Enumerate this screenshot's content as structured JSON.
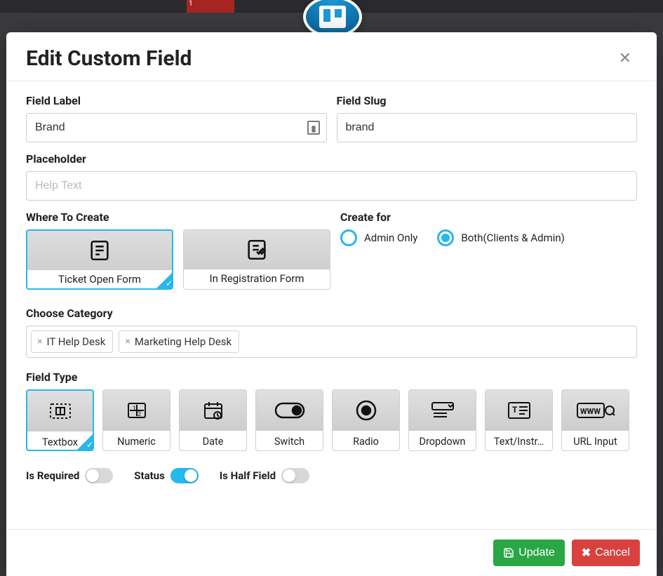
{
  "bg": {
    "badge": "1"
  },
  "modal": {
    "title": "Edit Custom Field",
    "fieldLabel": {
      "label": "Field Label",
      "value": "Brand"
    },
    "fieldSlug": {
      "label": "Field Slug",
      "value": "brand"
    },
    "placeholder": {
      "label": "Placeholder",
      "hint": "Help Text",
      "value": ""
    },
    "whereLabel": "Where To Create",
    "whereOptions": [
      {
        "label": "Ticket Open Form",
        "selected": true
      },
      {
        "label": "In Registration Form",
        "selected": false
      }
    ],
    "createForLabel": "Create for",
    "createForOptions": [
      {
        "label": "Admin Only",
        "checked": false
      },
      {
        "label": "Both(Clients & Admin)",
        "checked": true
      }
    ],
    "categoryLabel": "Choose Category",
    "categories": [
      "IT Help Desk",
      "Marketing Help Desk"
    ],
    "fieldTypeLabel": "Field Type",
    "fieldTypes": [
      {
        "label": "Textbox",
        "selected": true
      },
      {
        "label": "Numeric",
        "selected": false
      },
      {
        "label": "Date",
        "selected": false
      },
      {
        "label": "Switch",
        "selected": false
      },
      {
        "label": "Radio",
        "selected": false
      },
      {
        "label": "Dropdown",
        "selected": false
      },
      {
        "label": "Text/Instr…",
        "selected": false
      },
      {
        "label": "URL Input",
        "selected": false
      }
    ],
    "toggles": {
      "isRequired": {
        "label": "Is Required",
        "on": false
      },
      "status": {
        "label": "Status",
        "on": true
      },
      "isHalf": {
        "label": "Is Half Field",
        "on": false
      }
    },
    "buttons": {
      "update": "Update",
      "cancel": "Cancel"
    }
  }
}
